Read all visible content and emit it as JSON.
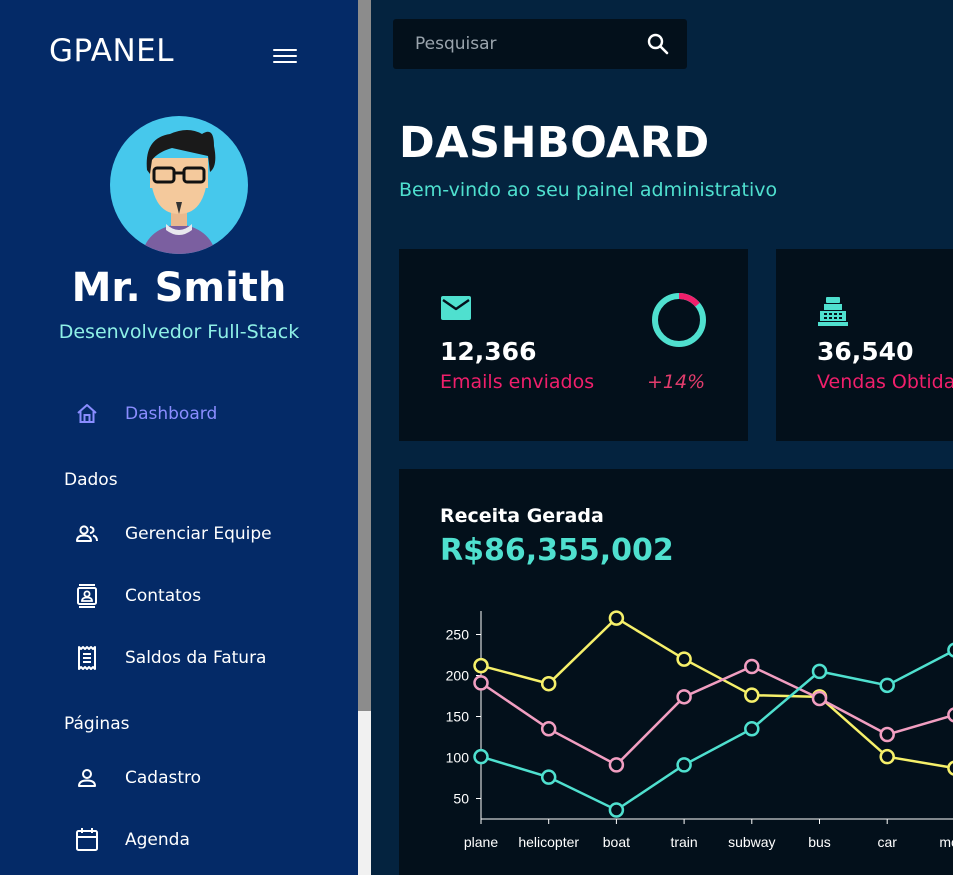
{
  "sidebar": {
    "brand": "GPANEL",
    "profile": {
      "name": "Mr. Smith",
      "role": "Desenvolvedor Full-Stack"
    },
    "nav": {
      "dashboard": "Dashboard",
      "section_data": "Dados",
      "team": "Gerenciar Equipe",
      "contacts": "Contatos",
      "invoices": "Saldos da Fatura",
      "section_pages": "Páginas",
      "profile_form": "Cadastro",
      "calendar": "Agenda"
    }
  },
  "search": {
    "placeholder": "Pesquisar"
  },
  "header": {
    "title": "DASHBOARD",
    "subtitle": "Bem-vindo ao seu painel administrativo"
  },
  "stats": [
    {
      "value": "12,366",
      "label": "Emails enviados",
      "increase": "+14%",
      "progress": 0.14,
      "icon": "email-icon"
    },
    {
      "value": "36,540",
      "label": "Vendas Obtidas",
      "icon": "cash-register-icon"
    }
  ],
  "revenue": {
    "title": "Receita Gerada",
    "total": "R$86,355,002"
  },
  "colors": {
    "accent": "#4fe0cf",
    "alert": "#f01f6b",
    "active_nav": "#8a8dff",
    "sidebar_bg": "#042a67",
    "card_bg": "#03101b"
  },
  "chart_data": {
    "type": "line",
    "categories": [
      "plane",
      "helicopter",
      "boat",
      "train",
      "subway",
      "bus",
      "car",
      "moto"
    ],
    "yticks": [
      50,
      100,
      150,
      200,
      250
    ],
    "ylim": [
      25,
      275
    ],
    "series": [
      {
        "color": "#f6f06a",
        "values": [
          212,
          190,
          270,
          220,
          176,
          174,
          101,
          87
        ]
      },
      {
        "color": "#f19ec1",
        "values": [
          191,
          135,
          91,
          174,
          211,
          172,
          128,
          152
        ]
      },
      {
        "color": "#4fe0cf",
        "values": [
          101,
          76,
          36,
          91,
          135,
          205,
          188,
          231
        ]
      }
    ]
  }
}
